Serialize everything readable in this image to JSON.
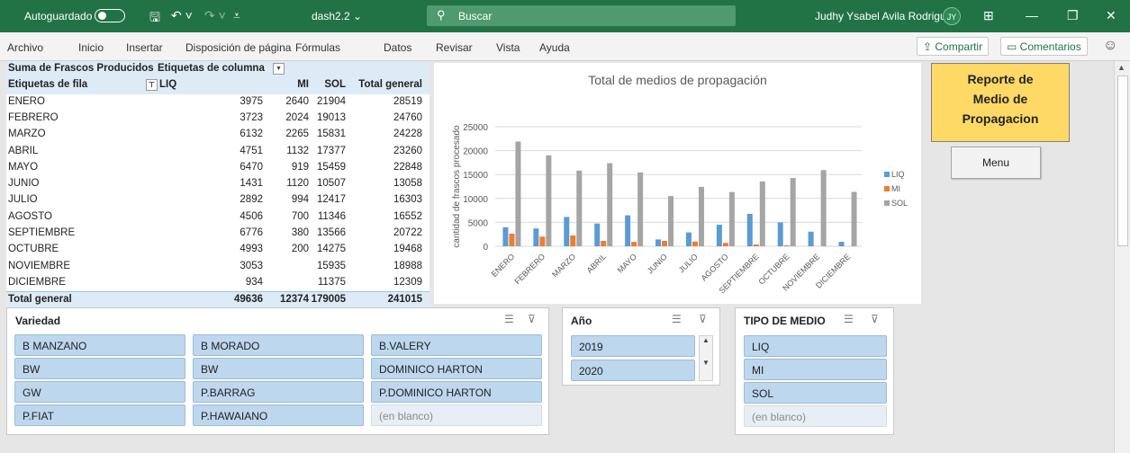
{
  "titlebar": {
    "autosave_label": "Autoguardado",
    "filename": "dash2.2 ⌄",
    "search_placeholder": "Buscar",
    "user_name": "Judhy Ysabel Avila Rodriguez",
    "user_initials": "JY",
    "bg_color": "#217346"
  },
  "ribbon": {
    "tabs": [
      "Archivo",
      "Inicio",
      "Insertar",
      "Disposición de página",
      "Fórmulas",
      "Datos",
      "Revisar",
      "Vista",
      "Ayuda"
    ],
    "share_label": "Compartir",
    "comments_label": "Comentarios"
  },
  "pivot": {
    "header1_left": "Suma de Frascos Producidos",
    "header1_right": "Etiquetas de columna",
    "header2_left": "Etiquetas de fila",
    "col_labels": [
      "LIQ",
      "MI",
      "SOL",
      "Total general"
    ],
    "rows": [
      {
        "label": "ENERO",
        "liq": "3975",
        "mi": "2640",
        "sol": "21904",
        "total": "28519"
      },
      {
        "label": "FEBRERO",
        "liq": "3723",
        "mi": "2024",
        "sol": "19013",
        "total": "24760"
      },
      {
        "label": "MARZO",
        "liq": "6132",
        "mi": "2265",
        "sol": "15831",
        "total": "24228"
      },
      {
        "label": "ABRIL",
        "liq": "4751",
        "mi": "1132",
        "sol": "17377",
        "total": "23260"
      },
      {
        "label": "MAYO",
        "liq": "6470",
        "mi": "919",
        "sol": "15459",
        "total": "22848"
      },
      {
        "label": "JUNIO",
        "liq": "1431",
        "mi": "1120",
        "sol": "10507",
        "total": "13058"
      },
      {
        "label": "JULIO",
        "liq": "2892",
        "mi": "994",
        "sol": "12417",
        "total": "16303"
      },
      {
        "label": "AGOSTO",
        "liq": "4506",
        "mi": "700",
        "sol": "11346",
        "total": "16552"
      },
      {
        "label": "SEPTIEMBRE",
        "liq": "6776",
        "mi": "380",
        "sol": "13566",
        "total": "20722"
      },
      {
        "label": "OCTUBRE",
        "liq": "4993",
        "mi": "200",
        "sol": "14275",
        "total": "19468"
      },
      {
        "label": "NOVIEMBRE",
        "liq": "3053",
        "mi": "",
        "sol": "15935",
        "total": "18988"
      },
      {
        "label": "DICIEMBRE",
        "liq": "934",
        "mi": "",
        "sol": "11375",
        "total": "12309"
      }
    ],
    "total_row": {
      "label": "Total general",
      "liq": "49636",
      "mi": "12374",
      "sol": "179005",
      "total": "241015"
    }
  },
  "chart_data": {
    "type": "bar",
    "title": "Total de medios de propagación",
    "xlabel": "",
    "ylabel": "cantidad de frascos procesado",
    "ylim": [
      0,
      25000
    ],
    "yticks": [
      "0",
      "5000",
      "10000",
      "15000",
      "20000",
      "25000"
    ],
    "categories": [
      "ENERO",
      "FEBRERO",
      "MARZO",
      "ABRIL",
      "MAYO",
      "JUNIO",
      "JULIO",
      "AGOSTO",
      "SEPTIEMBRE",
      "OCTUBRE",
      "NOVIEMBRE",
      "DICIEMBRE"
    ],
    "series": [
      {
        "name": "LIQ",
        "color": "#5b9bd5",
        "values": [
          3975,
          3723,
          6132,
          4751,
          6470,
          1431,
          2892,
          4506,
          6776,
          4993,
          3053,
          934
        ]
      },
      {
        "name": "MI",
        "color": "#ed7d31",
        "values": [
          2640,
          2024,
          2265,
          1132,
          919,
          1120,
          994,
          700,
          380,
          200,
          0,
          0
        ]
      },
      {
        "name": "SOL",
        "color": "#a5a5a5",
        "values": [
          21904,
          19013,
          15831,
          17377,
          15459,
          10507,
          12417,
          11346,
          13566,
          14275,
          15935,
          11375
        ]
      }
    ],
    "legend_position": "right",
    "grid": true
  },
  "report": {
    "title_line1": "Reporte de",
    "title_line2": "Medio de",
    "title_line3": "Propagacion",
    "bg_color": "#ffd966",
    "menu_label": "Menu"
  },
  "slicers": {
    "variedad": {
      "title": "Variedad",
      "items": [
        "B MANZANO",
        "B MORADO",
        "B.VALERY",
        "BW",
        "BW",
        "DOMINICO HARTON",
        "GW",
        "P.BARRAG",
        "P.DOMINICO HARTON",
        "P.FIAT",
        "P.HAWAIANO",
        "(en blanco)"
      ]
    },
    "anio": {
      "title": "Año",
      "items": [
        "2019",
        "2020"
      ]
    },
    "tipo": {
      "title": "TIPO DE MEDIO",
      "items": [
        "LIQ",
        "MI",
        "SOL",
        "(en blanco)"
      ]
    }
  }
}
